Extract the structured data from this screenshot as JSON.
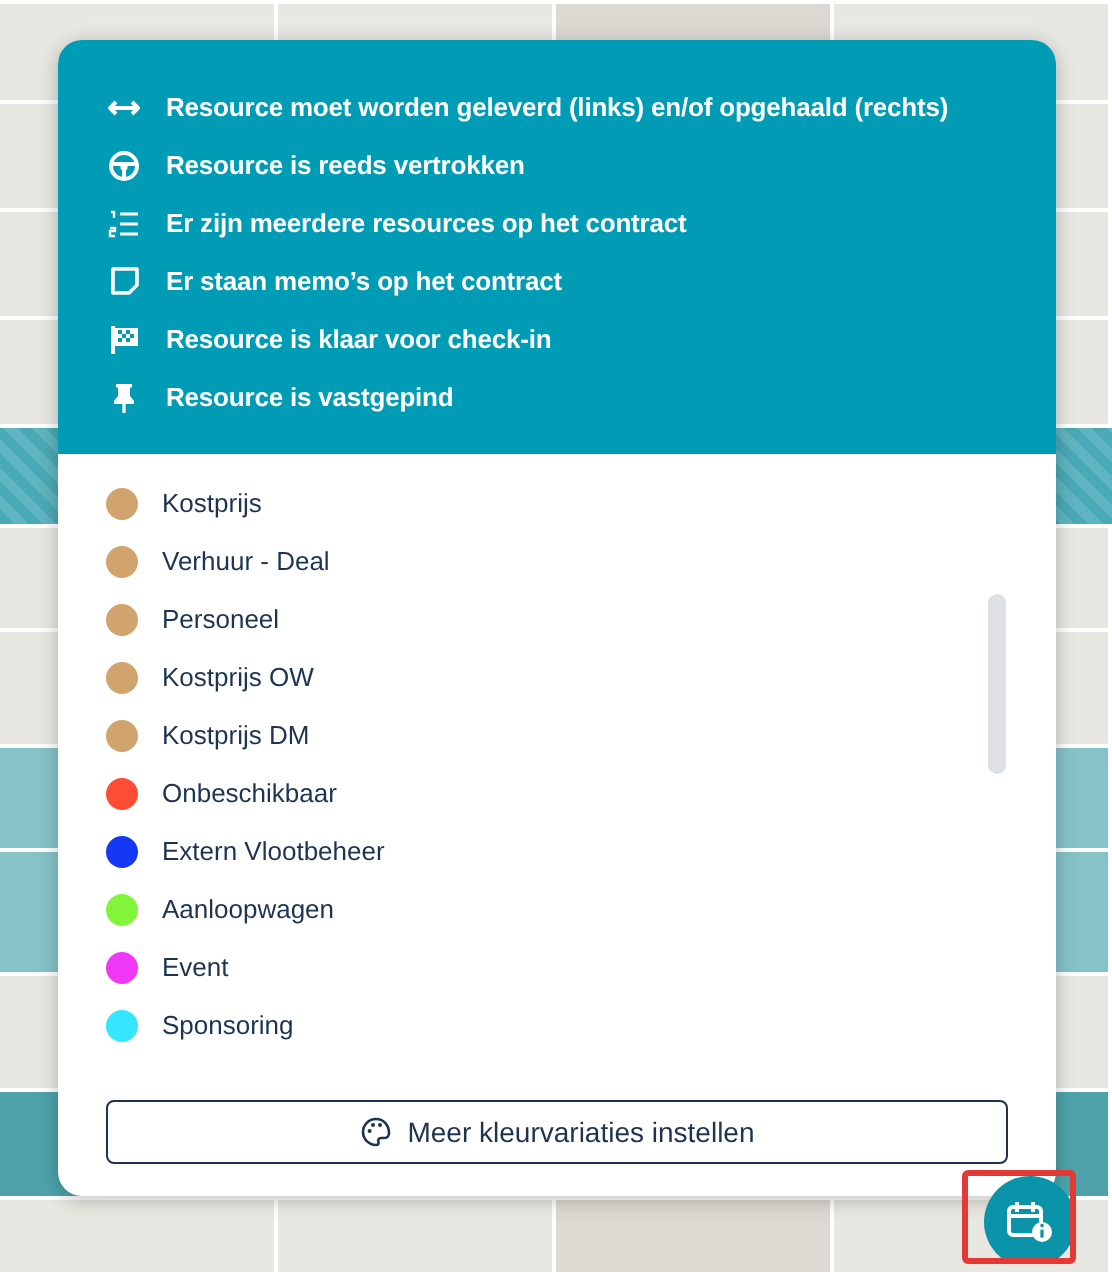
{
  "legend": [
    {
      "kind": "arrows",
      "text": "Resource moet worden geleverd (links) en/of opgehaald (rechts)"
    },
    {
      "kind": "wheel",
      "text": "Resource is reeds vertrokken"
    },
    {
      "kind": "list",
      "text": "Er zijn meerdere resources op het contract"
    },
    {
      "kind": "memo",
      "text": "Er staan memo’s op het contract"
    },
    {
      "kind": "flag",
      "text": "Resource is klaar voor check-in"
    },
    {
      "kind": "pin",
      "text": "Resource is vastgepind"
    }
  ],
  "colors": [
    {
      "name": "Kostprijs",
      "color": "#d0a46c"
    },
    {
      "name": "Verhuur - Deal",
      "color": "#d0a46c"
    },
    {
      "name": "Personeel",
      "color": "#d0a46c"
    },
    {
      "name": "Kostprijs OW",
      "color": "#d0a46c"
    },
    {
      "name": "Kostprijs DM",
      "color": "#d0a46c"
    },
    {
      "name": "Onbeschikbaar",
      "color": "#ff4c35"
    },
    {
      "name": "Extern Vlootbeheer",
      "color": "#1438f5"
    },
    {
      "name": "Aanloopwagen",
      "color": "#82f53a"
    },
    {
      "name": "Event",
      "color": "#ee38f5"
    },
    {
      "name": "Sponsoring",
      "color": "#35e6ff"
    }
  ],
  "more_colors_button": {
    "label": "Meer kleurvariaties instellen"
  }
}
